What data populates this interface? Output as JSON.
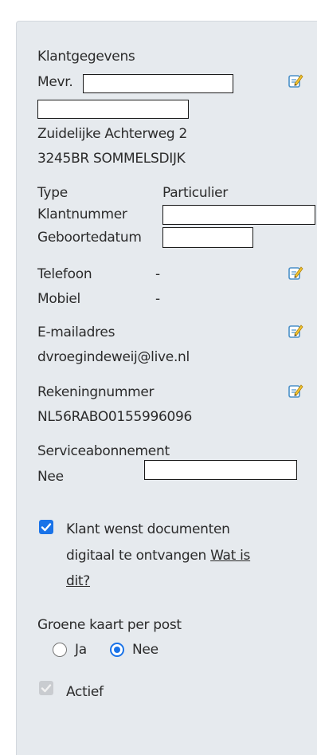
{
  "customer": {
    "heading": "Klantgegevens",
    "salutation": "Mevr.",
    "street": "Zuidelijke Achterweg 2",
    "postal_city": "3245BR SOMMELSDIJK"
  },
  "details": {
    "type_label": "Type",
    "type_value": "Particulier",
    "customer_number_label": "Klantnummer",
    "birthdate_label": "Geboortedatum"
  },
  "contact": {
    "phone_label": "Telefoon",
    "phone_value": "-",
    "mobile_label": "Mobiel",
    "mobile_value": "-",
    "email_label": "E-mailadres",
    "email_value": "dvroegindeweij@live.nl",
    "account_label": "Rekeningnummer",
    "account_value": "NL56RABO0155996096",
    "subscription_label": "Serviceabonnement",
    "subscription_value": "Nee"
  },
  "digital_docs": {
    "line1": "Klant wenst documenten",
    "line2": "digitaal te ontvangen ",
    "link_part1": "Wat is",
    "link_part2": "dit?",
    "checked": true
  },
  "green_card": {
    "label": "Groene kaart per post",
    "option_yes": "Ja",
    "option_no": "Nee",
    "selected": "Nee"
  },
  "active": {
    "label": "Actief",
    "checked": true,
    "disabled": true
  },
  "colors": {
    "panel_bg": "#e6eaee",
    "accent": "#1a73e8"
  },
  "icons": {
    "edit": "edit-note-icon"
  }
}
